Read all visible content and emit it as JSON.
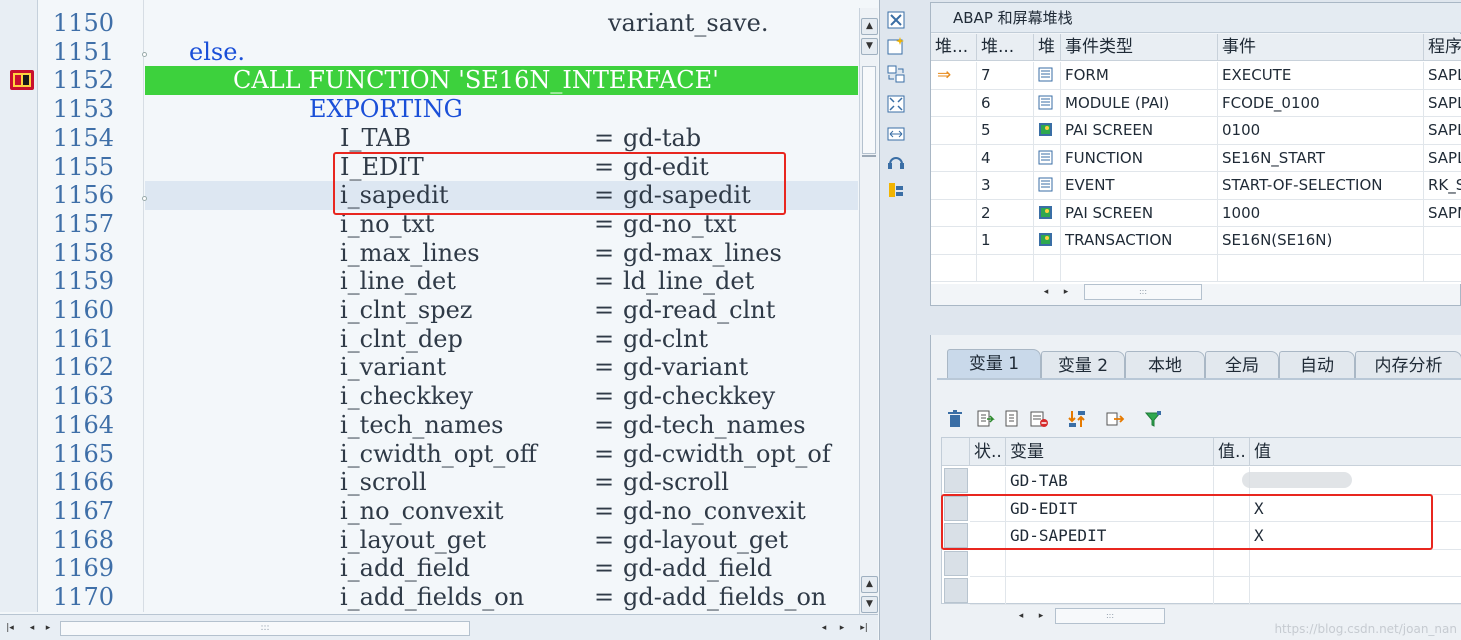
{
  "editor": {
    "lines": [
      {
        "num": "1150",
        "indent": "               ",
        "name": "variant_save.",
        "eq": "",
        "value": "",
        "kind": "plain"
      },
      {
        "num": "1151",
        "indent": "  ",
        "name": "else.",
        "eq": "",
        "value": "",
        "kind": "keyword"
      },
      {
        "num": "1152",
        "indent": "     ",
        "name": "CALL FUNCTION 'SE16N_INTERFACE'",
        "eq": "",
        "value": "",
        "kind": "exec"
      },
      {
        "num": "1153",
        "indent": "          ",
        "name": "EXPORTING",
        "eq": "",
        "value": "",
        "kind": "keyword"
      },
      {
        "num": "1154",
        "indent": "",
        "name": "I_TAB",
        "eq": "=",
        "value": "gd-tab",
        "kind": "param"
      },
      {
        "num": "1155",
        "indent": "",
        "name": "I_EDIT",
        "eq": "=",
        "value": "gd-edit",
        "kind": "param"
      },
      {
        "num": "1156",
        "indent": "",
        "name": "i_sapedit",
        "eq": "=",
        "value": "gd-sapedit",
        "kind": "param-selected"
      },
      {
        "num": "1157",
        "indent": "",
        "name": "i_no_txt",
        "eq": "=",
        "value": "gd-no_txt",
        "kind": "param"
      },
      {
        "num": "1158",
        "indent": "",
        "name": "i_max_lines",
        "eq": "=",
        "value": "gd-max_lines",
        "kind": "param"
      },
      {
        "num": "1159",
        "indent": "",
        "name": "i_line_det",
        "eq": "=",
        "value": "ld_line_det",
        "kind": "param"
      },
      {
        "num": "1160",
        "indent": "",
        "name": "i_clnt_spez",
        "eq": "=",
        "value": "gd-read_clnt",
        "kind": "param"
      },
      {
        "num": "1161",
        "indent": "",
        "name": "i_clnt_dep",
        "eq": "=",
        "value": "gd-clnt",
        "kind": "param"
      },
      {
        "num": "1162",
        "indent": "",
        "name": "i_variant",
        "eq": "=",
        "value": "gd-variant",
        "kind": "param"
      },
      {
        "num": "1163",
        "indent": "",
        "name": "i_checkkey",
        "eq": "=",
        "value": "gd-checkkey",
        "kind": "param"
      },
      {
        "num": "1164",
        "indent": "",
        "name": "i_tech_names",
        "eq": "=",
        "value": "gd-tech_names",
        "kind": "param"
      },
      {
        "num": "1165",
        "indent": "",
        "name": "i_cwidth_opt_off",
        "eq": "=",
        "value": "gd-cwidth_opt_of",
        "kind": "param"
      },
      {
        "num": "1166",
        "indent": "",
        "name": "i_scroll",
        "eq": "=",
        "value": "gd-scroll",
        "kind": "param"
      },
      {
        "num": "1167",
        "indent": "",
        "name": "i_no_convexit",
        "eq": "=",
        "value": "gd-no_convexit",
        "kind": "param"
      },
      {
        "num": "1168",
        "indent": "",
        "name": "i_layout_get",
        "eq": "=",
        "value": "gd-layout_get",
        "kind": "param"
      },
      {
        "num": "1169",
        "indent": "",
        "name": "i_add_field",
        "eq": "=",
        "value": "gd-add_field",
        "kind": "param"
      },
      {
        "num": "1170",
        "indent": "",
        "name": "i_add_fields_on",
        "eq": "=",
        "value": "gd-add_fields_on",
        "kind": "param"
      }
    ]
  },
  "stack": {
    "title": "ABAP 和屏幕堆栈",
    "headers": [
      "堆...",
      "堆...",
      "堆",
      "事件类型",
      "事件",
      "程序"
    ],
    "rows": [
      {
        "current": true,
        "level": "7",
        "icon": "form-icon",
        "type": "FORM",
        "event": "EXECUTE",
        "program": "SAPL"
      },
      {
        "current": false,
        "level": "6",
        "icon": "form-icon",
        "type": "MODULE (PAI)",
        "event": "FCODE_0100",
        "program": "SAPL"
      },
      {
        "current": false,
        "level": "5",
        "icon": "screen-icon",
        "type": "PAI SCREEN",
        "event": "0100",
        "program": "SAPL"
      },
      {
        "current": false,
        "level": "4",
        "icon": "form-icon",
        "type": "FUNCTION",
        "event": "SE16N_START",
        "program": "SAPL"
      },
      {
        "current": false,
        "level": "3",
        "icon": "form-icon",
        "type": "EVENT",
        "event": "START-OF-SELECTION",
        "program": "RK_S"
      },
      {
        "current": false,
        "level": "2",
        "icon": "screen-icon",
        "type": "PAI SCREEN",
        "event": "1000",
        "program": "SAPM"
      },
      {
        "current": false,
        "level": "1",
        "icon": "screen-icon",
        "type": "TRANSACTION",
        "event": "SE16N(SE16N)",
        "program": ""
      }
    ]
  },
  "variables": {
    "tabs": [
      "变量 1",
      "变量 2",
      "本地",
      "全局",
      "自动",
      "内存分析"
    ],
    "active_tab": 0,
    "headers": [
      "状..",
      "变量",
      "值..",
      "值"
    ],
    "rows": [
      {
        "name": "GD-TAB",
        "value": ""
      },
      {
        "name": "GD-EDIT",
        "value": "X"
      },
      {
        "name": "GD-SAPEDIT",
        "value": "X"
      },
      {
        "name": "",
        "value": ""
      },
      {
        "name": "",
        "value": ""
      }
    ]
  },
  "watermark": "https://blog.csdn.net/joan_nan",
  "colors": {
    "exec_line": "#3dd13d",
    "highlight_box": "#e8261f",
    "keyword": "#1a4fd8",
    "line_number": "#3f6fa8"
  }
}
